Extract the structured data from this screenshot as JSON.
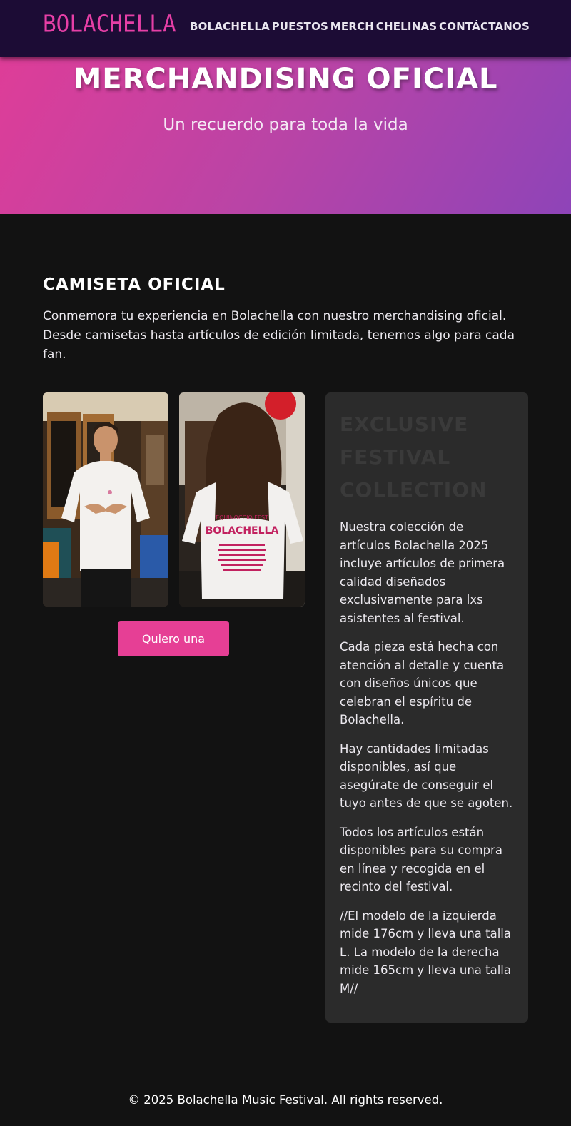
{
  "nav": {
    "logo": "BOLACHELLA",
    "links": [
      "Bolachella",
      "Puestos",
      "Merch",
      "Chelinas",
      "Contáctanos"
    ]
  },
  "hero": {
    "title": "MERCHANDISING OFICIAL",
    "subtitle": "Un recuerdo para toda la vida"
  },
  "main": {
    "title": "CAMISETA OFICIAL",
    "intro": "Conmemora tu experiencia en Bolachella con nuestro merchandising oficial. Desde camisetas hasta artículos de edición limitada, tenemos algo para cada fan.",
    "cta_label": "Quiero una",
    "shirt_print": {
      "top": "EQUINOCCIO FEST",
      "brand": "BOLACHELLA"
    }
  },
  "panel": {
    "title": "EXCLUSIVE FESTIVAL COLLECTION",
    "paragraphs": [
      "Nuestra colección de artículos Bolachella 2025 incluye artículos de primera calidad diseñados exclusivamente para lxs asistentes al festival.",
      "Cada pieza está hecha con atención al detalle y cuenta con diseños únicos que celebran el espíritu de Bolachella.",
      "Hay cantidades limitadas disponibles, así que asegúrate de conseguir el tuyo antes de que se agoten.",
      "Todos los artículos están disponibles para su compra en línea y recogida en el recinto del festival.",
      "//El modelo de la izquierda mide 176cm y lleva una talla L. La modelo de la derecha mide 165cm y lleva una talla M//"
    ]
  },
  "footer": {
    "text": "© 2025 Bolachella Music Festival. All rights reserved."
  },
  "colors": {
    "nav_bg": "#1c0c35",
    "accent": "#e63f95",
    "hero_start": "#de3d98",
    "hero_end": "#8e44b8",
    "page_bg": "#121212",
    "panel_bg": "#2b2b2b"
  }
}
